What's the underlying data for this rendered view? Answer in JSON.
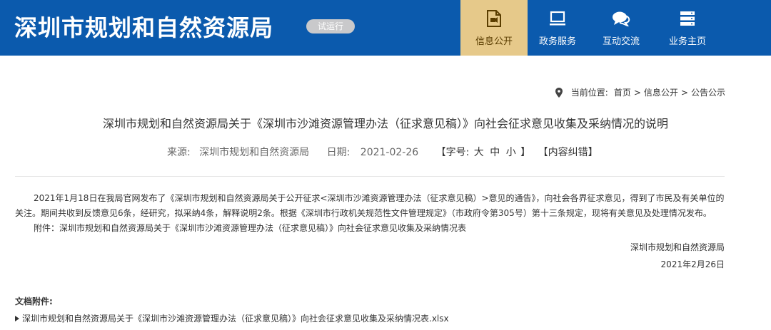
{
  "header": {
    "site_title": "深圳市规划和自然资源局",
    "trial_badge": "试运行",
    "nav": [
      {
        "label": "信息公开",
        "icon": "document-icon",
        "active": true
      },
      {
        "label": "政务服务",
        "icon": "monitor-icon",
        "active": false
      },
      {
        "label": "互动交流",
        "icon": "chat-icon",
        "active": false
      },
      {
        "label": "业务主页",
        "icon": "server-icon",
        "active": false
      }
    ]
  },
  "breadcrumb": {
    "label": "当前位置:",
    "items": [
      "首页",
      "信息公开",
      "公告公示"
    ],
    "separator": ">"
  },
  "article": {
    "title": "深圳市规划和自然资源局关于《深圳市沙滩资源管理办法（征求意见稿）》向社会征求意见收集及采纳情况的说明",
    "source_label": "来源:",
    "source": "深圳市规划和自然资源局",
    "date_label": "日期:",
    "date": "2021-02-26",
    "fontsize_label": "【字号:",
    "fontsize_large": "大",
    "fontsize_medium": "中",
    "fontsize_small": "小",
    "fontsize_close": "】",
    "correct_label": "【内容纠错】",
    "paragraph": "2021年1月18日在我局官网发布了《深圳市规划和自然资源局关于公开征求<深圳市沙滩资源管理办法（征求意见稿）>意见的通告》，向社会各界征求意见，得到了市民及有关单位的关注。期间共收到反馈意见6条，经研究，拟采纳4条，解释说明2条。根据《深圳市行政机关规范性文件管理规定》（市政府令第305号）第十三条规定，现将有关意见及处理情况发布。",
    "attachment_line": "附件：深圳市规划和自然资源局关于《深圳市沙滩资源管理办法（征求意见稿）》向社会征求意见收集及采纳情况表",
    "signature_org": "深圳市规划和自然资源局",
    "signature_date": "2021年2月26日",
    "files_label": "文档附件:",
    "file_name": "深圳市规划和自然资源局关于《深圳市沙滩资源管理办法（征求意见稿）》向社会征求意见收集及采纳情况表.xlsx"
  },
  "colors": {
    "header_bg": "#0b5aad",
    "active_nav_bg": "#e6c98a",
    "badge_bg": "#c9c9cb"
  }
}
